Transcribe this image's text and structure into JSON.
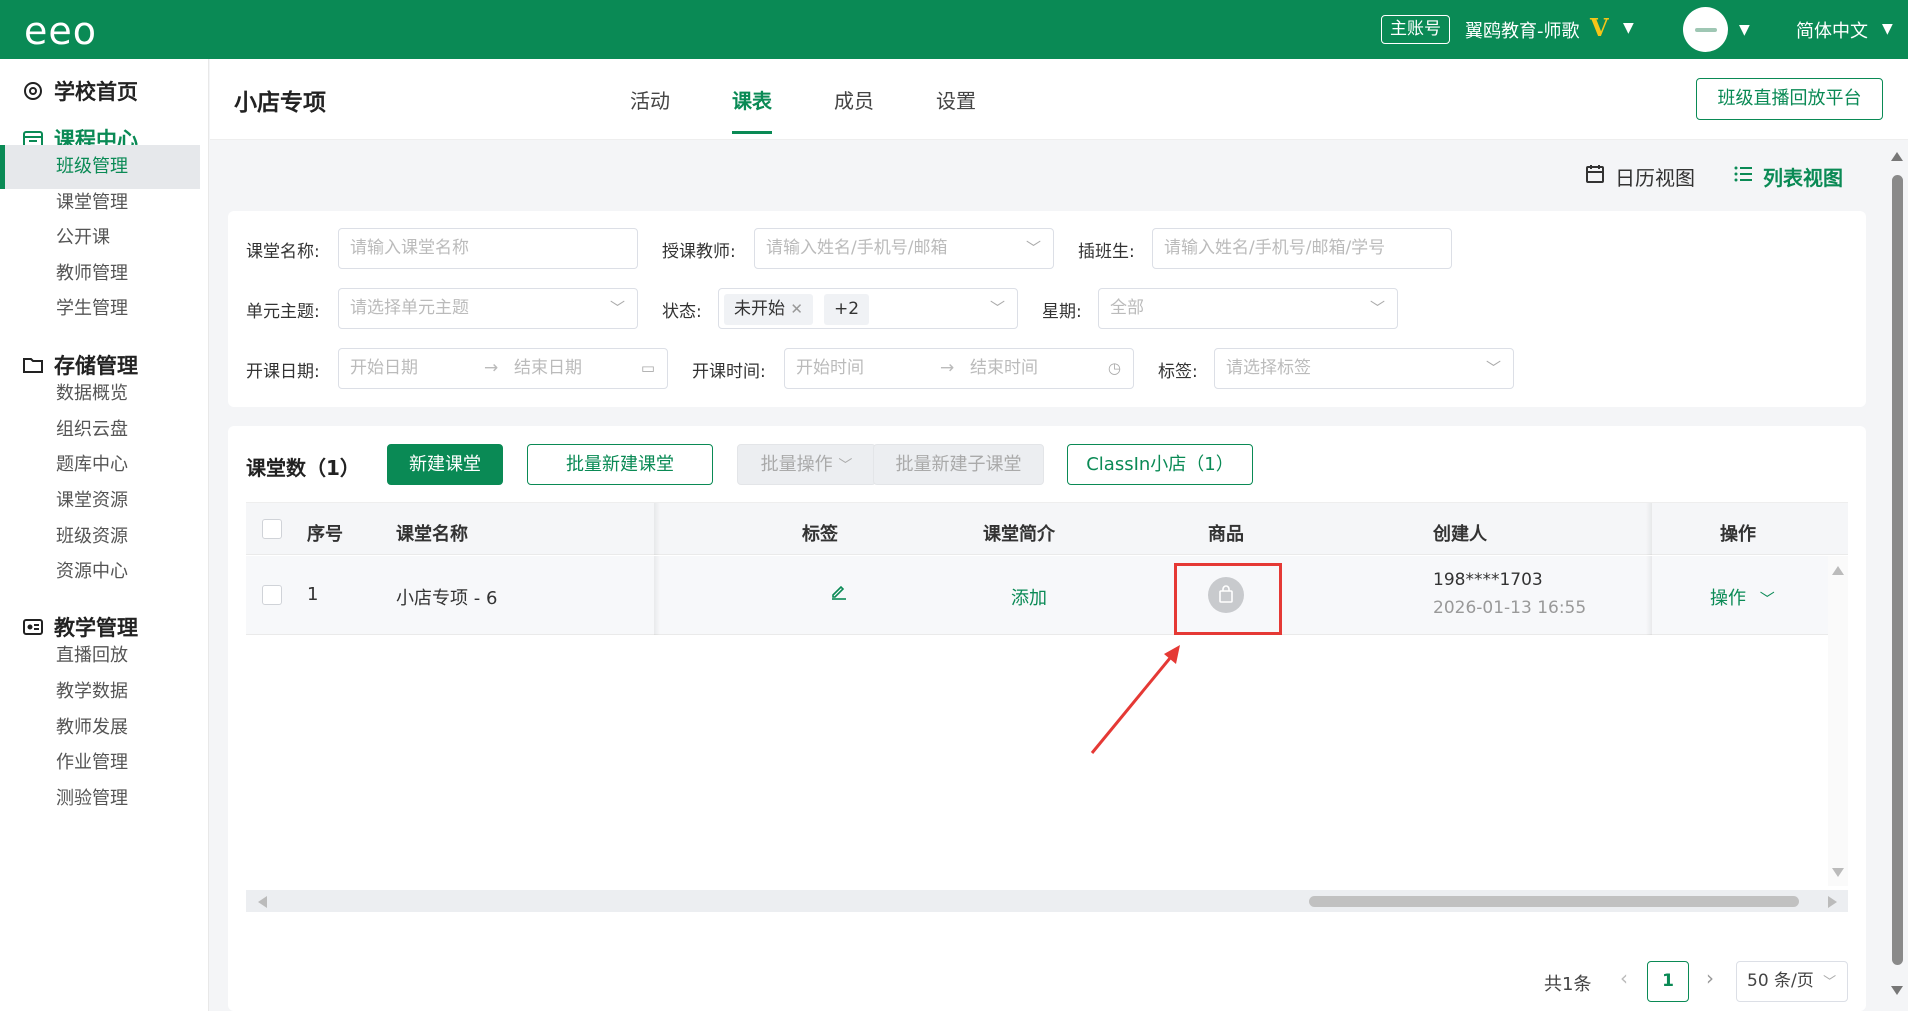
{
  "topbar": {
    "logo": "eeo",
    "role_badge": "主账号",
    "org_name": "翼鸥教育-师歌",
    "vip_mark": "V",
    "language": "简体中文"
  },
  "sidebar": {
    "sections": [
      {
        "label": "学校首页",
        "icon": "gear-icon"
      },
      {
        "label": "课程中心",
        "icon": "calendar-icon",
        "active": true
      },
      {
        "label": "存储管理",
        "icon": "folder-icon"
      },
      {
        "label": "教学管理",
        "icon": "teaching-icon"
      }
    ],
    "course_items": [
      "班级管理",
      "课堂管理",
      "公开课",
      "教师管理",
      "学生管理"
    ],
    "storage_items": [
      "数据概览",
      "组织云盘",
      "题库中心",
      "课堂资源",
      "班级资源",
      "资源中心"
    ],
    "teaching_items": [
      "直播回放",
      "教学数据",
      "教师发展",
      "作业管理",
      "测验管理"
    ],
    "active_item": "班级管理"
  },
  "header": {
    "title": "小店专项",
    "tabs": [
      "活动",
      "课表",
      "成员",
      "设置"
    ],
    "active_tab": "课表",
    "platform_button": "班级直播回放平台"
  },
  "view_toggle": {
    "calendar_view": "日历视图",
    "list_view": "列表视图",
    "active": "列表视图"
  },
  "filters": {
    "course_name_label": "课堂名称",
    "course_name_placeholder": "请输入课堂名称",
    "teacher_label": "授课教师",
    "teacher_placeholder": "请输入姓名/手机号/邮箱",
    "transfer_label": "插班生",
    "transfer_placeholder": "请输入姓名/手机号/邮箱/学号",
    "unit_label": "单元主题",
    "unit_placeholder": "请选择单元主题",
    "status_label": "状态",
    "status_chip": "未开始",
    "status_more": "+2",
    "weekday_label": "星期",
    "weekday_value": "全部",
    "start_date_label": "开课日期",
    "start_date_placeholder": "开始日期",
    "end_date_placeholder": "结束日期",
    "start_time_label": "开课时间",
    "start_time_placeholder": "开始时间",
    "end_time_placeholder": "结束时间",
    "tag_label": "标签",
    "tag_placeholder": "请选择标签",
    "colon": ":"
  },
  "table_card": {
    "count_label": "课堂数（1）",
    "new_button": "新建课堂",
    "batch_new_button": "批量新建课堂",
    "batch_ops_button": "批量操作",
    "batch_sub_button": "批量新建子课堂",
    "classin_shop_button": "ClassIn小店（1）",
    "columns": [
      "序号",
      "课堂名称",
      "标签",
      "课堂简介",
      "商品",
      "创建人",
      "操作"
    ],
    "rows": [
      {
        "index": "1",
        "name": "小店专项 - 6",
        "intro_action": "添加",
        "creator": "198****1703",
        "created_at": "2026-01-13 16:55",
        "operation": "操作"
      }
    ]
  },
  "pagination": {
    "total": "共1条",
    "current_page": "1",
    "page_size": "50 条/页"
  },
  "colors": {
    "brand": "#0a8a55",
    "highlight_box": "#e53935"
  }
}
